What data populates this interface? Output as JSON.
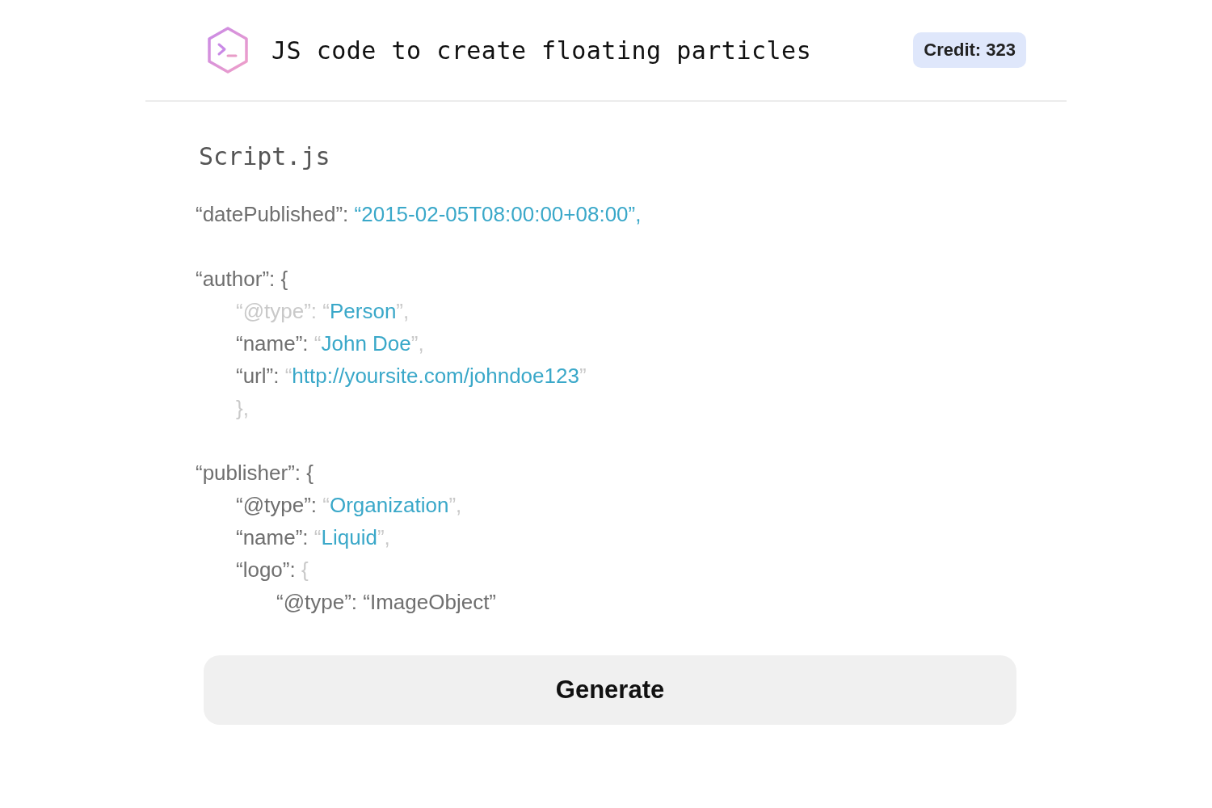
{
  "header": {
    "title": "JS code to create floating particles",
    "credit": "Credit: 323"
  },
  "file": {
    "name": "Script.js"
  },
  "code": {
    "blocks": [
      {
        "lines": [
          {
            "segments": [
              {
                "kind": "key",
                "text": "“datePublished”: "
              },
              {
                "kind": "value",
                "text": "“2015-02-05T08:00:00+08:00”,"
              }
            ]
          }
        ]
      },
      {
        "lines": [
          {
            "segments": [
              {
                "kind": "key",
                "text": "“author”: {"
              }
            ],
            "children": [
              {
                "segments": [
                  {
                    "kind": "faint",
                    "text": "“@type”: “"
                  },
                  {
                    "kind": "value",
                    "text": "Person"
                  },
                  {
                    "kind": "faint",
                    "text": "”,"
                  }
                ]
              },
              {
                "segments": [
                  {
                    "kind": "key",
                    "text": "“name”: "
                  },
                  {
                    "kind": "faint",
                    "text": "“"
                  },
                  {
                    "kind": "value",
                    "text": "John Doe"
                  },
                  {
                    "kind": "faint",
                    "text": "”,"
                  }
                ]
              },
              {
                "segments": [
                  {
                    "kind": "key",
                    "text": "“url”: "
                  },
                  {
                    "kind": "faint",
                    "text": "“"
                  },
                  {
                    "kind": "value",
                    "text": "http://yoursite.com/johndoe123"
                  },
                  {
                    "kind": "faint",
                    "text": "”"
                  }
                ]
              },
              {
                "segments": [
                  {
                    "kind": "faint",
                    "text": "},"
                  }
                ]
              }
            ]
          }
        ]
      },
      {
        "lines": [
          {
            "segments": [
              {
                "kind": "key",
                "text": "“publisher”: {"
              }
            ],
            "children": [
              {
                "segments": [
                  {
                    "kind": "key",
                    "text": "“@type”: "
                  },
                  {
                    "kind": "faint",
                    "text": "“"
                  },
                  {
                    "kind": "value",
                    "text": "Organization"
                  },
                  {
                    "kind": "faint",
                    "text": "”,"
                  }
                ]
              },
              {
                "segments": [
                  {
                    "kind": "key",
                    "text": "“name”: "
                  },
                  {
                    "kind": "faint",
                    "text": "“"
                  },
                  {
                    "kind": "value",
                    "text": "Liquid"
                  },
                  {
                    "kind": "faint",
                    "text": "”,"
                  }
                ]
              },
              {
                "segments": [
                  {
                    "kind": "key",
                    "text": "“logo”: "
                  },
                  {
                    "kind": "faint",
                    "text": "{"
                  }
                ],
                "children": [
                  {
                    "segments": [
                      {
                        "kind": "key",
                        "text": "“@type”: “ImageObject”"
                      }
                    ]
                  }
                ]
              }
            ]
          }
        ]
      }
    ]
  },
  "button": {
    "label": "Generate"
  }
}
